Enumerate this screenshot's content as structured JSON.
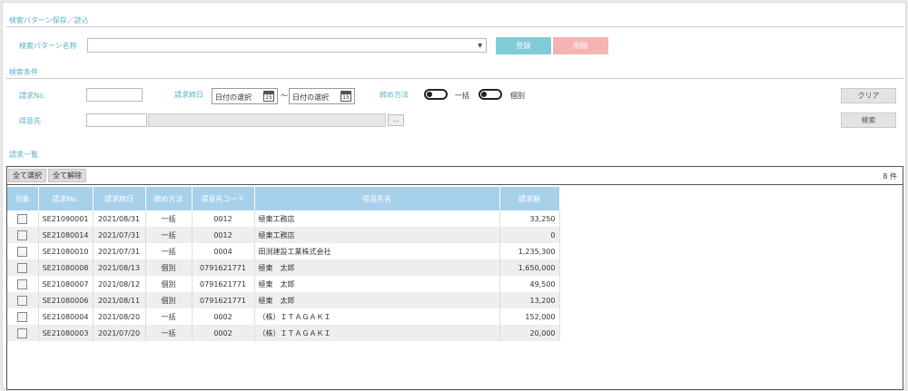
{
  "pattern_section": {
    "title": "検索パターン保存／読込",
    "name_label": "検索パターン名称",
    "name_value": "",
    "register_label": "登録",
    "delete_label": "削除"
  },
  "conditions": {
    "title": "検索条件",
    "invoice_no_label": "請求No.",
    "invoice_no_value": "",
    "date_label": "請求締日",
    "date_from_placeholder": "日付の選択",
    "date_to_placeholder": "日付の選択",
    "date_separator": "～",
    "calendar_day": "15",
    "closing_label": "締め方法",
    "closing_option_bulk": "一括",
    "closing_option_individual": "個別",
    "customer_label": "得意先",
    "customer_code_value": "",
    "customer_name_value": "",
    "lookup_label": "…",
    "clear_label": "クリア",
    "search_label": "検索"
  },
  "list": {
    "title": "請求一覧",
    "select_all_label": "全て選択",
    "deselect_all_label": "全て解除",
    "count_text": "8 件",
    "columns": [
      "対象",
      "請求No.",
      "請求締日",
      "締め方法",
      "得意先コード",
      "得意先名",
      "請求額"
    ],
    "rows": [
      {
        "no": "SE21090001",
        "date": "2021/08/31",
        "method": "一括",
        "code": "0012",
        "name": "極東工務店",
        "amount": "33,250"
      },
      {
        "no": "SE21080014",
        "date": "2021/07/31",
        "method": "一括",
        "code": "0012",
        "name": "極東工務店",
        "amount": "0"
      },
      {
        "no": "SE21080010",
        "date": "2021/07/31",
        "method": "一括",
        "code": "0004",
        "name": "田渕建設工業株式会社",
        "amount": "1,235,300"
      },
      {
        "no": "SE21080008",
        "date": "2021/08/13",
        "method": "個別",
        "code": "0791621771",
        "name": "極東　太郎",
        "amount": "1,650,000"
      },
      {
        "no": "SE21080007",
        "date": "2021/08/12",
        "method": "個別",
        "code": "0791621771",
        "name": "極東　太郎",
        "amount": "49,500"
      },
      {
        "no": "SE21080006",
        "date": "2021/08/11",
        "method": "個別",
        "code": "0791621771",
        "name": "極東　太郎",
        "amount": "13,200"
      },
      {
        "no": "SE21080004",
        "date": "2021/08/20",
        "method": "一括",
        "code": "0002",
        "name": "（株）ＩＴＡＧＡＫＩ",
        "amount": "152,000"
      },
      {
        "no": "SE21080003",
        "date": "2021/07/20",
        "method": "一括",
        "code": "0002",
        "name": "（株）ＩＴＡＧＡＫＩ",
        "amount": "20,000"
      }
    ]
  }
}
